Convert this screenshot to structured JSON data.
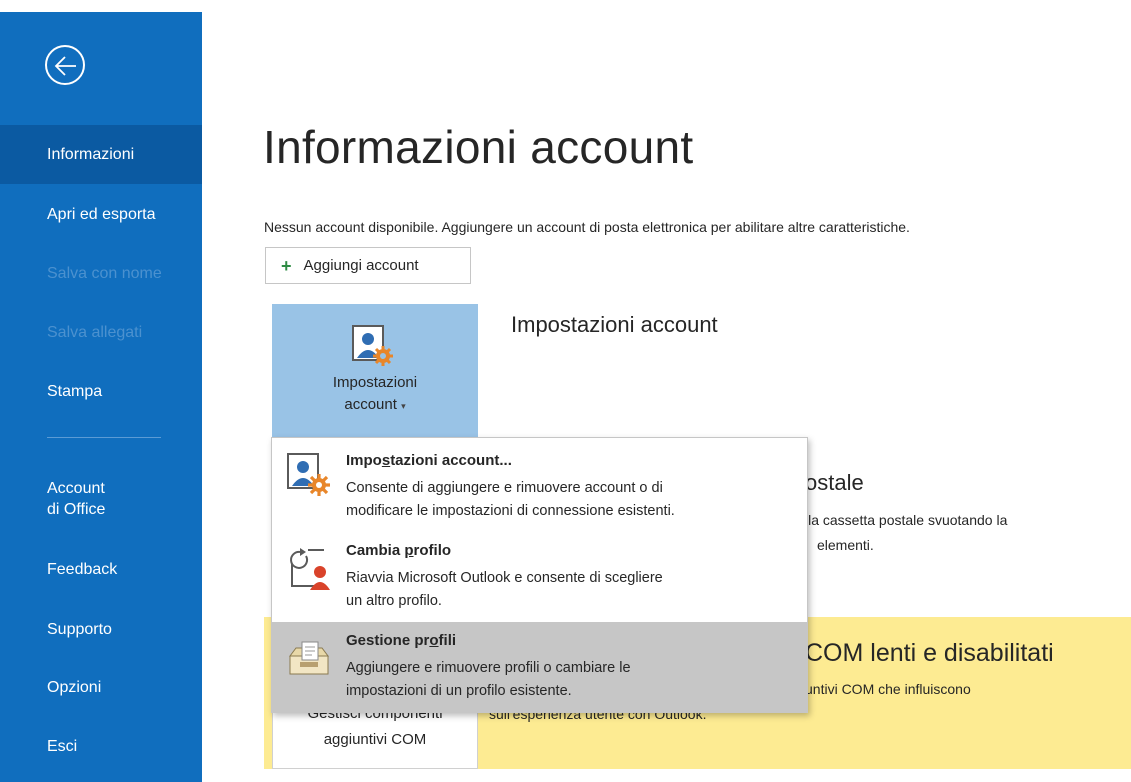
{
  "sidebar": {
    "back_label": "Indietro",
    "items": [
      {
        "label": "Informazioni"
      },
      {
        "label": "Apri ed esporta"
      },
      {
        "label": "Salva con nome"
      },
      {
        "label": "Salva allegati"
      },
      {
        "label": "Stampa"
      },
      {
        "label_line1": "Account",
        "label_line2": "di Office"
      },
      {
        "label": "Feedback"
      },
      {
        "label": "Supporto"
      },
      {
        "label": "Opzioni"
      },
      {
        "label": "Esci"
      }
    ]
  },
  "main": {
    "title": "Informazioni account",
    "description": "Nessun account disponibile. Aggiungere un account di posta elettronica per abilitare altre caratteristiche.",
    "add_account_label": "Aggiungi account",
    "settings_tile": {
      "label_line1": "Impostazioni",
      "label_line2": "account"
    },
    "settings_section_title": "Impostazioni account",
    "mailbox_section_title": "ostale",
    "mailbox_text_line1": "lla cassetta postale svuotando la",
    "mailbox_text_line2": "elementi.",
    "com_section_title": "COM lenti e disabilitati",
    "com_text_line1": "untivi COM che influiscono",
    "com_text_line2": "sull'esperienza utente con Outlook.",
    "com_tile": {
      "label_line1": "Gestisci componenti",
      "label_line2": "aggiuntivi COM"
    }
  },
  "dropdown": {
    "items": [
      {
        "title_pre": "Impo",
        "title_accel": "s",
        "title_post": "tazioni account...",
        "desc_line1": "Consente di aggiungere e rimuovere account o di",
        "desc_line2": "modificare le impostazioni di connessione esistenti.",
        "icon": "account-settings-icon"
      },
      {
        "title_pre": "Cambia ",
        "title_accel": "p",
        "title_post": "rofilo",
        "desc_line1": "Riavvia Microsoft Outlook e consente di scegliere",
        "desc_line2": "un altro profilo.",
        "icon": "change-profile-icon"
      },
      {
        "title_pre": "Gestione pr",
        "title_accel": "o",
        "title_post": "fili",
        "desc_line1": "Aggiungere e rimuovere profili o cambiare le",
        "desc_line2": "impostazioni di un profilo esistente.",
        "icon": "manage-profiles-icon"
      }
    ]
  },
  "colors": {
    "sidebar": "#106ebe",
    "sidebar_active": "#0b5aa2",
    "tile": "#99c3e6",
    "yellow": "#fdeb92",
    "hover": "#c6c6c6"
  }
}
